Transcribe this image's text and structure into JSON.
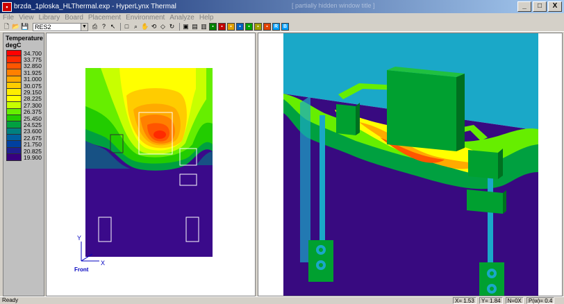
{
  "window": {
    "title": "brzda_1ploska_HLThermal.exp - HyperLynx Thermal",
    "background_title": "[ partially hidden window title ]",
    "buttons": {
      "minimize": "_",
      "maximize": "□",
      "close": "X"
    }
  },
  "menu": [
    "File",
    "View",
    "Library",
    "Board",
    "Placement",
    "Environment",
    "Analyze",
    "Help"
  ],
  "toolbar": {
    "component_select": "RES2"
  },
  "legend": {
    "title_line1": "Temperature",
    "title_line2": "degC",
    "entries": [
      {
        "value": "34.700",
        "color": "#ff0000"
      },
      {
        "value": "33.775",
        "color": "#ff2a00"
      },
      {
        "value": "32.850",
        "color": "#ff5500"
      },
      {
        "value": "31.925",
        "color": "#ff8000"
      },
      {
        "value": "31.000",
        "color": "#ffaa00"
      },
      {
        "value": "30.075",
        "color": "#ffcc00"
      },
      {
        "value": "29.150",
        "color": "#ffee00"
      },
      {
        "value": "28.225",
        "color": "#ffff00"
      },
      {
        "value": "27.300",
        "color": "#c8ff00"
      },
      {
        "value": "26.375",
        "color": "#66ee00"
      },
      {
        "value": "25.450",
        "color": "#22cc00"
      },
      {
        "value": "24.525",
        "color": "#00a040"
      },
      {
        "value": "23.600",
        "color": "#008080"
      },
      {
        "value": "22.675",
        "color": "#0060a0"
      },
      {
        "value": "21.750",
        "color": "#0040a0"
      },
      {
        "value": "20.825",
        "color": "#202090"
      },
      {
        "value": "19.900",
        "color": "#380080"
      }
    ]
  },
  "left_view": {
    "axis_y": "Y",
    "axis_x": "X",
    "front_label": "Front"
  },
  "status": {
    "text": "Ready",
    "x": "X= 1.53",
    "y": "Y= 1.84",
    "n": "N=0X",
    "p": "P(w)= 0.4"
  }
}
